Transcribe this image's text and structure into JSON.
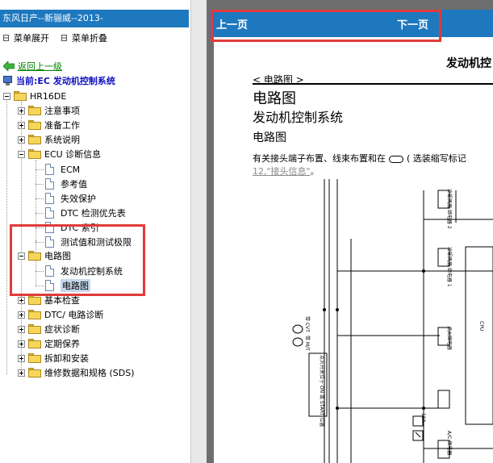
{
  "tree_panel": {
    "title": "东风日产--新骊威--2013-",
    "expand_all": "菜单展开",
    "collapse_all": "菜单折叠",
    "back": "返回上一级",
    "current": "当前:EC 发动机控制系统",
    "root": "HR16DE",
    "nodes": [
      {
        "label": "注意事项"
      },
      {
        "label": "准备工作"
      },
      {
        "label": "系统说明"
      },
      {
        "label": "ECU 诊断信息"
      },
      {
        "label": "ECM"
      },
      {
        "label": "参考值"
      },
      {
        "label": "失效保护"
      },
      {
        "label": "DTC 检测优先表"
      },
      {
        "label": "DTC 索引"
      },
      {
        "label": "测试值和测试极限"
      },
      {
        "label": "电路图"
      },
      {
        "label": "发动机控制系统"
      },
      {
        "label": "电路图"
      },
      {
        "label": "基本检查"
      },
      {
        "label": "DTC/ 电路诊断"
      },
      {
        "label": "症状诊断"
      },
      {
        "label": "定期保养"
      },
      {
        "label": "拆卸和安装"
      },
      {
        "label": "维修数据和规格 (SDS)"
      }
    ]
  },
  "viewer": {
    "prev": "上一页",
    "next": "下一页",
    "doc_header": "发动机控",
    "section_tag": "< 电路图 >",
    "title1": "电路图",
    "title2": "发动机控制系统",
    "title3": "电路图",
    "note_pre": "有关接头端子布置、线束布置和在",
    "note_post": "( 选装缩写标记",
    "note_link_num": "12,",
    "note_link_text": "\"接头信息\"",
    "note_link_end": "。",
    "diagram_labels": {
      "relay2": "冷却风扇 继电器 2",
      "relay1": "冷却风扇 继电器 1",
      "cvt": "带 CVT",
      "mt": "带 M/T",
      "ignition": "点火开关位于 ON 或 START 位置",
      "ign_relay": "点火继电器",
      "cpu": "CPU",
      "fuse": "10A",
      "acc": "A/C 继电器"
    }
  },
  "colors": {
    "accent_blue": "#1e78be",
    "highlight_red": "#e23a3a",
    "link_green": "#008000"
  }
}
